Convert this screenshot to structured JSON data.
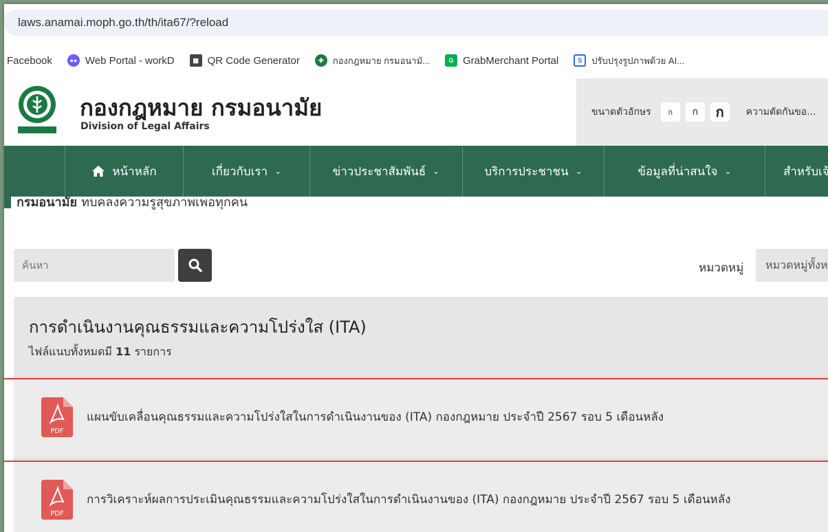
{
  "browser": {
    "url": "laws.anamai.moph.go.th/th/ita67/?reload",
    "bookmarks": [
      {
        "label": "Facebook",
        "icon": "none"
      },
      {
        "label": "Web Portal - workD",
        "icon": "chat-bubble-icon",
        "color": "#6a5cff"
      },
      {
        "label": "QR Code Generator",
        "icon": "qr-code-icon",
        "color": "#444444"
      },
      {
        "label": "กองกฎหมาย กรมอนามั...",
        "icon": "anamai-logo-icon",
        "color": "#1b7a43"
      },
      {
        "label": "GrabMerchant Portal",
        "icon": "grab-icon",
        "color": "#00b14f"
      },
      {
        "label": "ปรับปรุงรูปภาพด้วย AI...",
        "icon": "s-logo-icon",
        "color": "#2a6ae6"
      }
    ]
  },
  "header": {
    "title": "กองกฎหมาย กรมอนามัย",
    "subtitle": "Division of Legal Affairs",
    "font_size_label": "ขนาดตัวอักษร",
    "font_size_buttons": [
      "ก",
      "ก",
      "ก"
    ],
    "contrast_label": "ความตัดกันขอ..."
  },
  "nav": {
    "items": [
      {
        "label": "หน้าหลัก",
        "icon": "home-icon"
      },
      {
        "label": "เกี่ยวกับเรา"
      },
      {
        "label": "ข่าวประชาสัมพันธ์"
      },
      {
        "label": "บริการประชาชน"
      },
      {
        "label": "ข้อมูลที่น่าสนใจ"
      },
      {
        "label": "สำหรับเจ้าห"
      }
    ]
  },
  "tagline": {
    "bold": "กรมอนามัย",
    "text": "ทบคลงความรูสุขภาพเพอทุกคน"
  },
  "search": {
    "placeholder": "ค้นหา",
    "category_label": "หมวดหมู่",
    "category_value": "หมวดหมู่ทั้งห"
  },
  "content": {
    "title": "การดำเนินงานคุณธรรมและความโปร่งใส (ITA)",
    "count_prefix": "ไฟล์แนบทั้งหมดมี",
    "count": "11",
    "count_suffix": "รายการ",
    "files": [
      {
        "title": "แผนขับเคลื่อนคุณธรรมและความโปร่งใสในการดำเนินงานของ (ITA) กองกฎหมาย ประจำปี 2567 รอบ 5 เดือนหลัง",
        "icon_label": "PDF"
      },
      {
        "title": "การวิเคราะห์ผลการประเมินคุณธรรมและความโปร่งใสในการดำเนินงานของ (ITA) กองกฎหมาย ประจำปี 2567 รอบ 5 เดือนหลัง",
        "icon_label": "PDF"
      }
    ]
  },
  "colors": {
    "nav": "#2d6a4f",
    "pdf": "#e05a57",
    "highlight": "#e23b3b"
  }
}
